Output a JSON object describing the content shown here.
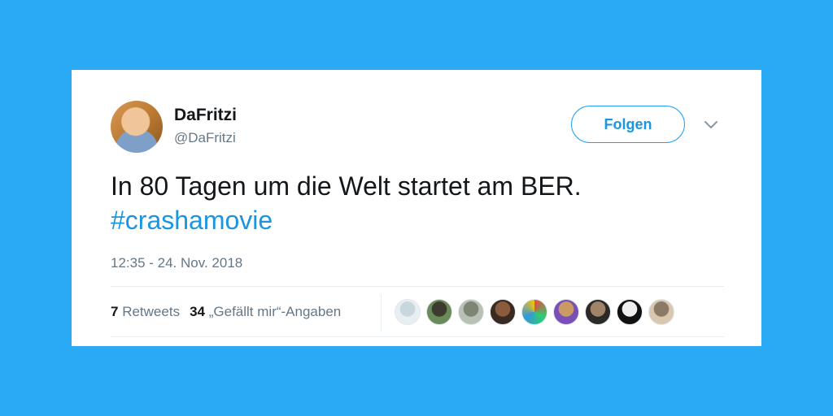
{
  "user": {
    "display_name": "DaFritzi",
    "handle": "@DaFritzi",
    "avatar_icon": "profile-photo"
  },
  "follow_label": "Folgen",
  "caret_icon": "chevron-down-icon",
  "tweet": {
    "text": "In 80 Tagen um die Welt startet am BER.",
    "hashtag": "#crashamovie",
    "timestamp": "12:35 - 24. Nov. 2018"
  },
  "stats": {
    "retweets_count": "7",
    "retweets_label": "Retweets",
    "likes_count": "34",
    "likes_label": "„Gefällt mir“-Angaben"
  },
  "likers": [
    {
      "name": "liker-avatar-1",
      "colors": [
        "#e8eef2",
        "#c8d6de"
      ]
    },
    {
      "name": "liker-avatar-2",
      "colors": [
        "#6b8a5a",
        "#3d3a2f"
      ]
    },
    {
      "name": "liker-avatar-3",
      "colors": [
        "#b9c0b4",
        "#7d8577"
      ]
    },
    {
      "name": "liker-avatar-4",
      "colors": [
        "#3a2a22",
        "#8a5b3c"
      ]
    },
    {
      "name": "liker-avatar-5",
      "colors": [
        "#e84c3d",
        "#2ecc71",
        "#3498db",
        "#f1c40f"
      ]
    },
    {
      "name": "liker-avatar-6",
      "colors": [
        "#7a4fb8",
        "#c99a63"
      ]
    },
    {
      "name": "liker-avatar-7",
      "colors": [
        "#2c2a28",
        "#a08468"
      ]
    },
    {
      "name": "liker-avatar-8",
      "colors": [
        "#111111",
        "#eeeeee"
      ]
    },
    {
      "name": "liker-avatar-9",
      "colors": [
        "#d9c7b0",
        "#8c7a66"
      ]
    }
  ],
  "colors": {
    "background": "#2aa9f4",
    "accent": "#1b95e0",
    "text_primary": "#14171a",
    "text_secondary": "#657786"
  }
}
